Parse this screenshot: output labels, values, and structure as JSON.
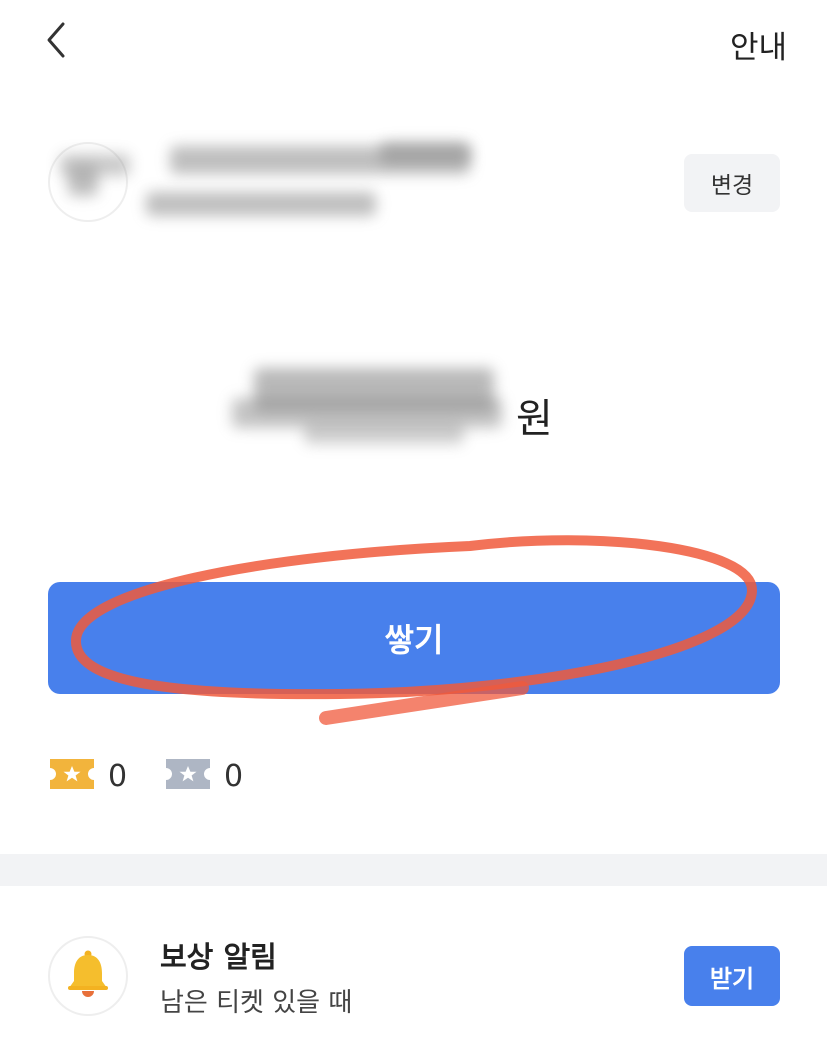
{
  "header": {
    "back_icon": "chevron-left-icon",
    "guide_label": "안내"
  },
  "account": {
    "change_label": "변경"
  },
  "amount": {
    "unit": "원"
  },
  "primary_action": {
    "label": "쌓기"
  },
  "tickets": [
    {
      "icon": "gold-ticket-icon",
      "count": "0",
      "color": "#f2b43c"
    },
    {
      "icon": "gray-ticket-icon",
      "count": "0",
      "color": "#aeb6c4"
    }
  ],
  "reward_notice": {
    "icon": "bell-icon",
    "title": "보상 알림",
    "subtitle": "남은 티켓 있을 때",
    "action_label": "받기"
  },
  "colors": {
    "accent": "#4880ec",
    "annotation": "#f05a3c",
    "divider": "#f2f3f5"
  }
}
